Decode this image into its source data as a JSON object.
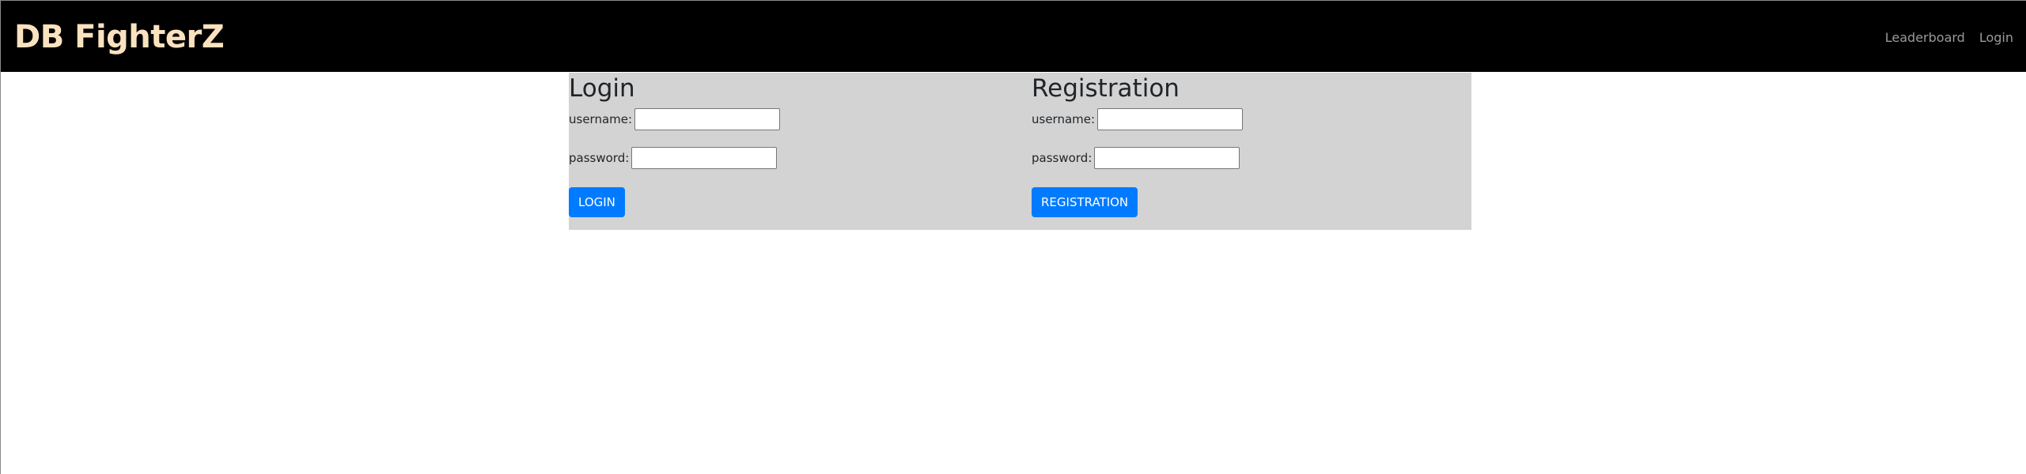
{
  "navbar": {
    "brand": "DB FighterZ",
    "links": [
      {
        "label": "Leaderboard"
      },
      {
        "label": "Login"
      }
    ]
  },
  "login": {
    "title": "Login",
    "username_label": "username:",
    "username_value": "",
    "password_label": "password:",
    "password_value": "",
    "button_label": "LOGIN"
  },
  "registration": {
    "title": "Registration",
    "username_label": "username:",
    "username_value": "",
    "password_label": "password:",
    "password_value": "",
    "button_label": "REGISTRATION"
  },
  "colors": {
    "navbar_bg": "#000000",
    "brand": "#fbe2bf",
    "nav_link": "#9a9a9a",
    "panel_bg": "#d3d3d3",
    "button_bg": "#007bff",
    "button_text": "#ffffff"
  }
}
